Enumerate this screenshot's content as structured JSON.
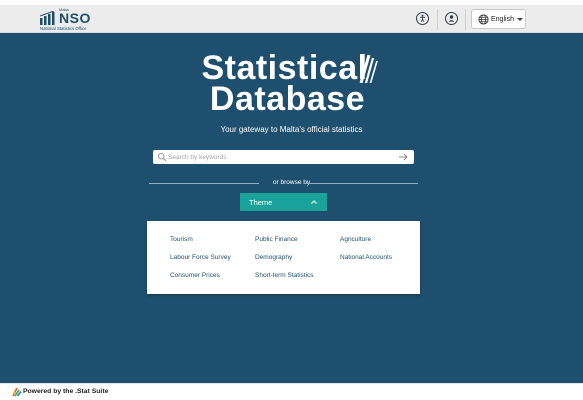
{
  "header": {
    "logo_small": "Malta",
    "logo_name": "NSO",
    "logo_subtitle": "National Statistics Office",
    "accessibility_icon": "accessibility-icon",
    "account_icon": "user-icon",
    "language": {
      "icon": "globe-icon",
      "label": "English"
    }
  },
  "hero": {
    "title_line1": "Statistical",
    "title_line2": "Database",
    "subtitle": "Your gateway to Malta's official statistics",
    "search": {
      "placeholder": "Search by keywords",
      "value": ""
    },
    "browse_label": "or browse by",
    "browse_select": "Theme",
    "themes": [
      {
        "label": "Tourism"
      },
      {
        "label": "Public Finance"
      },
      {
        "label": "Agriculture"
      },
      {
        "label": "Labour Force Survey"
      },
      {
        "label": "Demography"
      },
      {
        "label": "National Accounts"
      },
      {
        "label": "Consumer Prices"
      },
      {
        "label": "Short-term Statistics"
      }
    ]
  },
  "footer": {
    "label": "Powered by the .Stat Suite"
  },
  "colors": {
    "hero_background": "#1e4f6e",
    "accent": "#1aa39a",
    "header_background": "#ececec",
    "topic_link": "#1e4f6e"
  }
}
